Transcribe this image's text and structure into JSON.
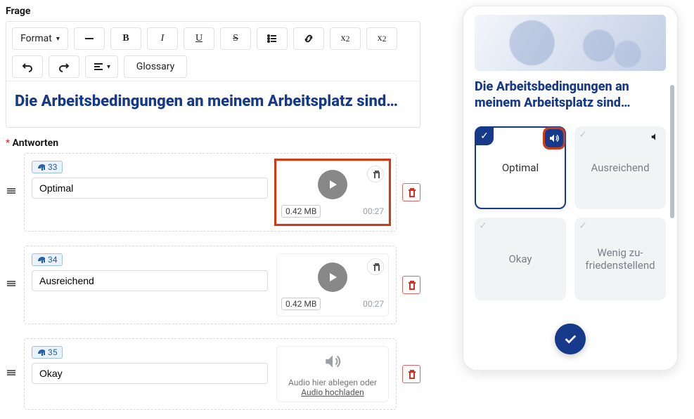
{
  "labels": {
    "question": "Frage",
    "answers": "Antworten"
  },
  "toolbar": {
    "format": "Format",
    "bold": "B",
    "italic": "I",
    "underline": "U",
    "strike": "S",
    "sup": "x",
    "sup_exp": "2",
    "sub": "x",
    "sub_exp": "2",
    "glossary": "Glossary"
  },
  "question_text": "Die Arbeitsbedingungen an meinem Arbeitsplatz sind…",
  "answers": [
    {
      "fp_id": "33",
      "text": "Optimal",
      "audio": {
        "size": "0.42 MB",
        "duration": "00:27",
        "highlight": true
      }
    },
    {
      "fp_id": "34",
      "text": "Ausreichend",
      "audio": {
        "size": "0.42 MB",
        "duration": "00:27",
        "highlight": false
      }
    },
    {
      "fp_id": "35",
      "text": "Okay",
      "audio": null
    }
  ],
  "audio_empty": {
    "hint": "Audio hier ablegen oder",
    "link": "Audio hochladen"
  },
  "preview": {
    "title": "Die Arbeitsbedingungen an meinem Arbeitsplatz sind…",
    "options": [
      {
        "label": "Optimal",
        "selected": true,
        "speaker_highlight": true
      },
      {
        "label": "Ausrei­chend",
        "selected": false
      },
      {
        "label": "Okay",
        "selected": false
      },
      {
        "label": "Wenig zu­friedenstel­lend",
        "selected": false
      }
    ]
  }
}
